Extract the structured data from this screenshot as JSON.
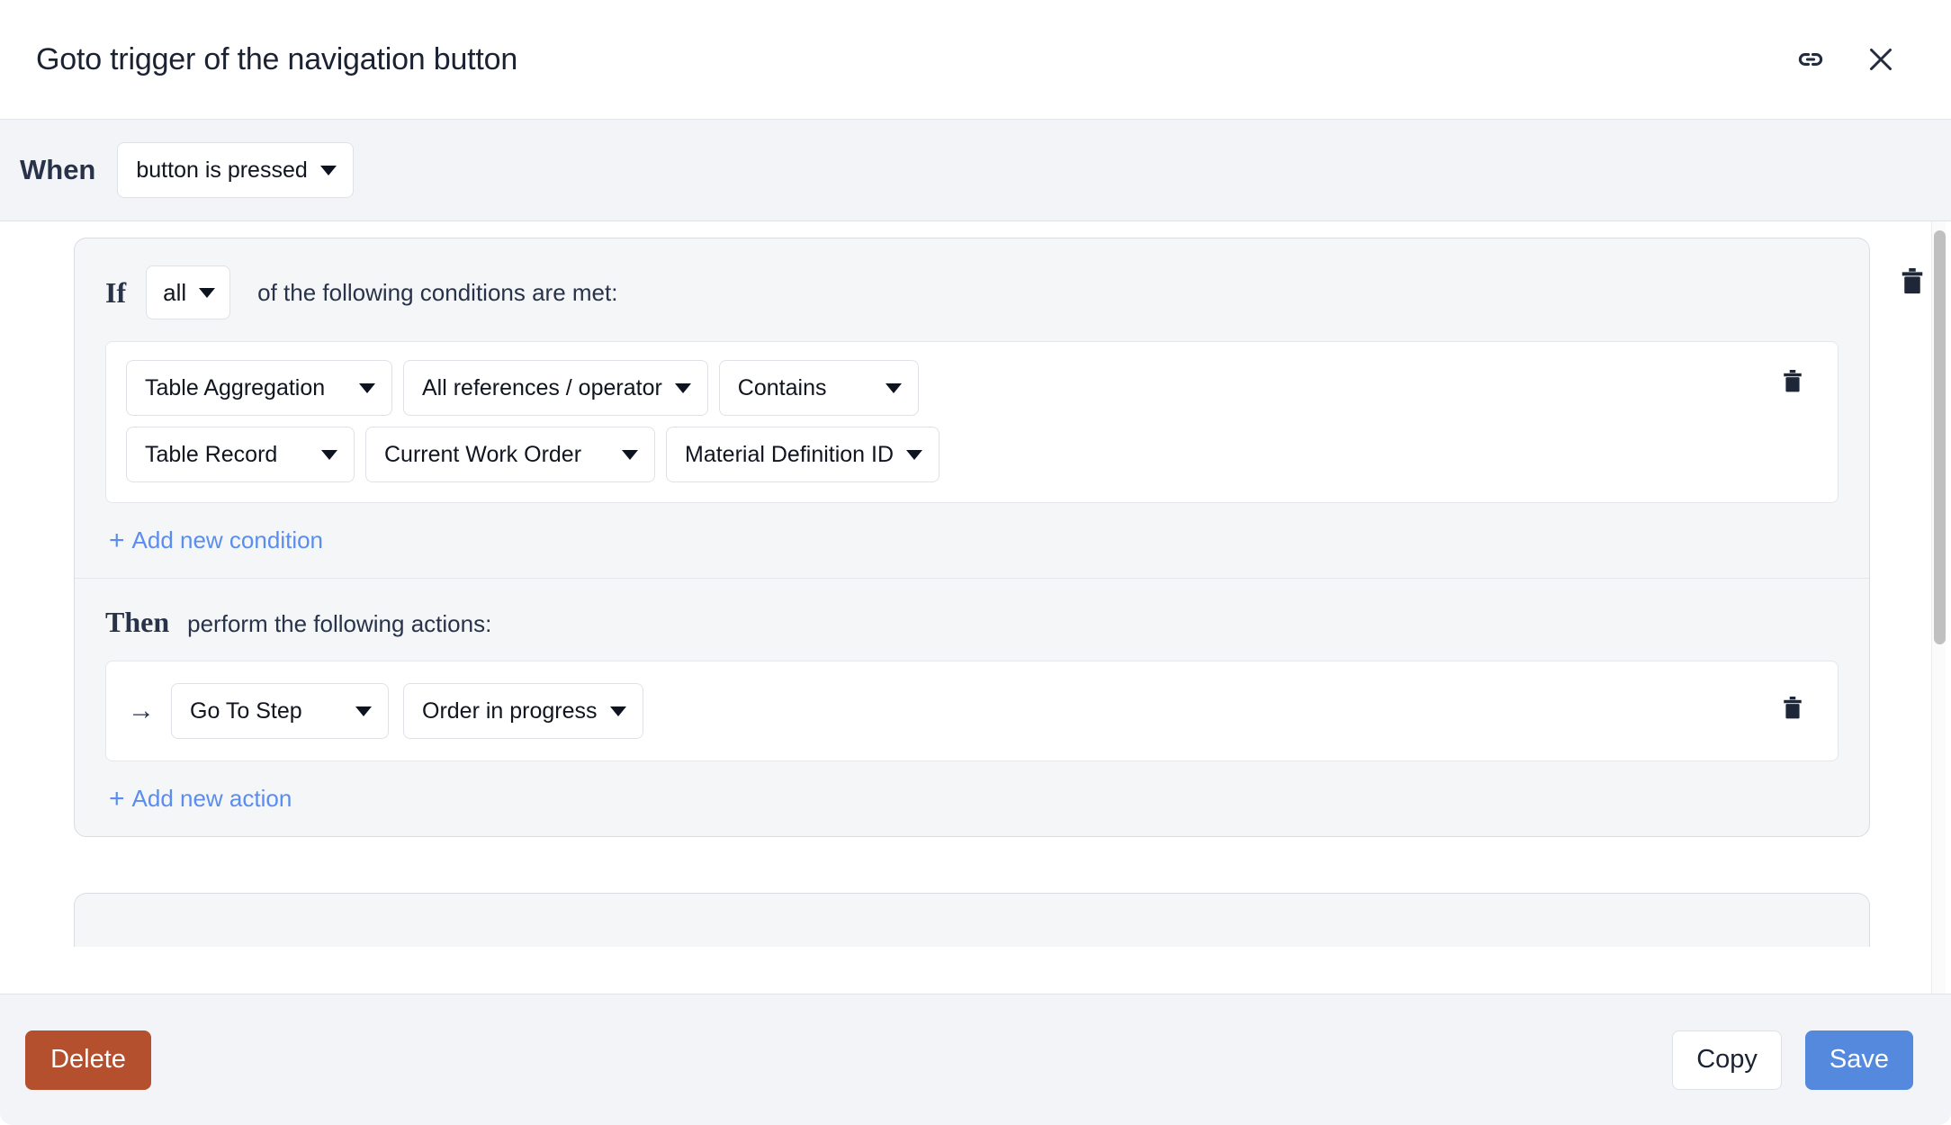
{
  "header": {
    "title": "Goto trigger of the navigation button",
    "link_icon": "link-icon",
    "close_icon": "close-icon"
  },
  "when": {
    "label": "When",
    "trigger_value": "button is pressed"
  },
  "rule": {
    "if": {
      "label": "If",
      "match_value": "all",
      "suffix_text": "of the following conditions are met:",
      "conditions": [
        {
          "left": "Table Aggregation",
          "middle": "All references / operator",
          "right": "Contains"
        },
        {
          "left": "Table Record",
          "middle": "Current Work Order",
          "right": "Material Definition ID"
        }
      ],
      "add_condition_label": "Add new condition",
      "add_plus": "+"
    },
    "then": {
      "label": "Then",
      "suffix_text": "perform the following actions:",
      "actions": [
        {
          "arrow": "→",
          "type": "Go To Step",
          "target": "Order in progress"
        }
      ],
      "add_action_label": "Add new action",
      "add_plus": "+"
    },
    "delete_rule_icon": "trash-icon",
    "delete_condition_icon": "trash-icon",
    "delete_action_icon": "trash-icon"
  },
  "footer": {
    "delete_label": "Delete",
    "copy_label": "Copy",
    "save_label": "Save"
  },
  "colors": {
    "accent_blue": "#5589dd",
    "link_blue": "#5b8def",
    "delete_red": "#b5502f",
    "text_dark": "#1b2232",
    "panel_gray": "#f2f4f7"
  }
}
